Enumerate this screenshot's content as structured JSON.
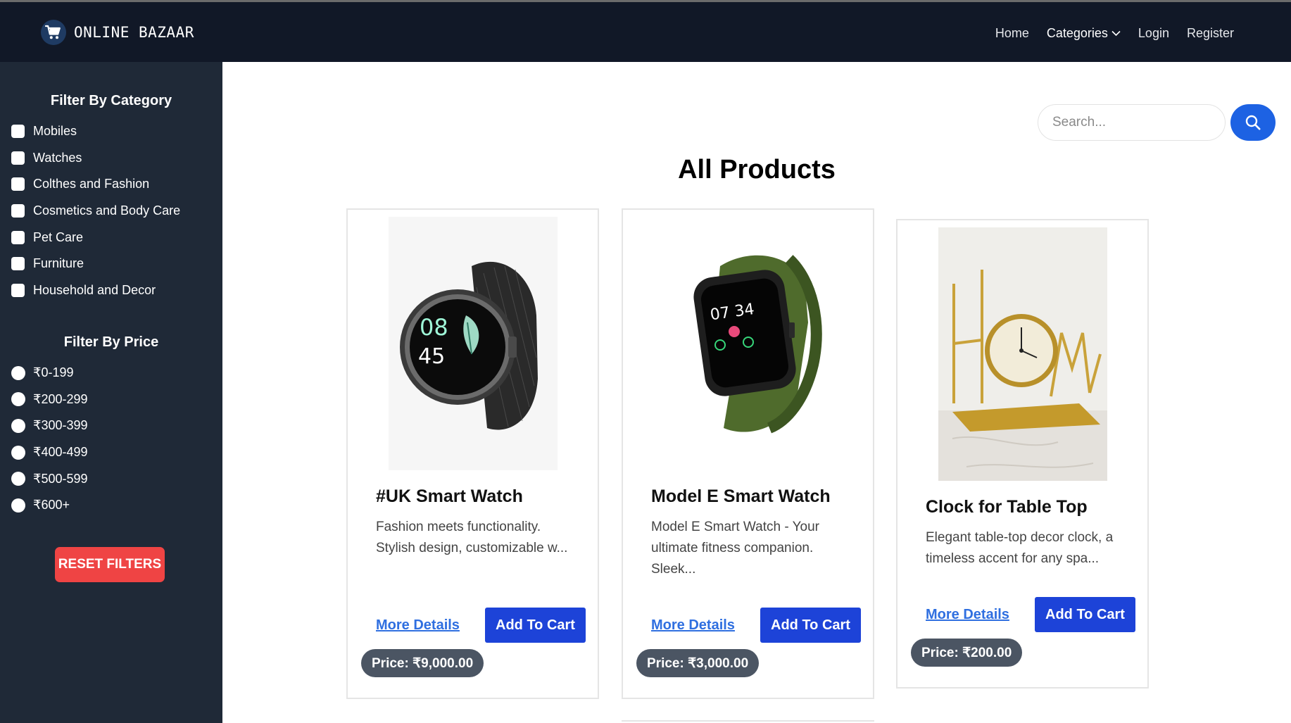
{
  "navbar": {
    "brand": "ONLINE BAZAAR",
    "brand_icon": "shopping-cart-icon",
    "links": [
      "Home",
      "Categories",
      "Login",
      "Register"
    ]
  },
  "sidebar": {
    "category_title": "Filter By Category",
    "categories": [
      "Mobiles",
      "Watches",
      "Colthes and Fashion",
      "Cosmetics and Body Care",
      "Pet Care",
      "Furniture",
      "Household and Decor"
    ],
    "price_title": "Filter By Price",
    "prices": [
      "₹0-199",
      "₹200-299",
      "₹300-399",
      "₹400-499",
      "₹500-599",
      "₹600+"
    ],
    "reset_label": "RESET FILTERS"
  },
  "search": {
    "placeholder": "Search..."
  },
  "main": {
    "title": "All Products"
  },
  "products": [
    {
      "name": "#UK Smart Watch",
      "description": "Fashion meets functionality. Stylish design, customizable w...",
      "more_label": "More Details",
      "cart_label": "Add To Cart",
      "price": "Price: ₹9,000.00",
      "watch_time_hour": "08",
      "watch_time_min": "45"
    },
    {
      "name": "Model E Smart Watch",
      "description": "Model E Smart Watch - Your ultimate fitness companion. Sleek...",
      "more_label": "More Details",
      "cart_label": "Add To Cart",
      "price": "Price: ₹3,000.00",
      "watch_time": "07 34"
    },
    {
      "name": "Clock for Table Top",
      "description": "Elegant table-top decor clock, a timeless accent for any spa...",
      "more_label": "More Details",
      "cart_label": "Add To Cart",
      "price": "Price: ₹200.00"
    }
  ],
  "colors": {
    "navbar_bg": "#111827",
    "sidebar_bg": "#1f2937",
    "reset_red": "#ef4444",
    "primary_blue": "#1d43d8",
    "link_blue": "#2f6fe0",
    "price_gray": "#4b5563"
  }
}
